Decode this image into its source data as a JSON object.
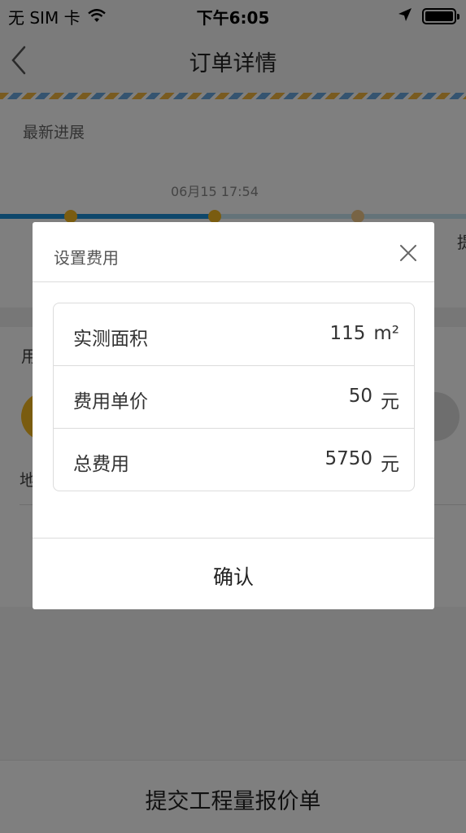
{
  "status_bar": {
    "carrier": "无 SIM 卡",
    "time": "下午6:05"
  },
  "nav": {
    "title": "订单详情"
  },
  "background": {
    "latest_progress_label": "最新进展",
    "progress_time": "06月15 17:54",
    "partial_labels": {
      "yong": "用",
      "di": "地",
      "ti": "提"
    },
    "submit_button_label": "提交工程量报价单"
  },
  "modal": {
    "title": "设置费用",
    "rows": [
      {
        "label": "实测面积",
        "value": "115",
        "unit": "m²"
      },
      {
        "label": "费用单价",
        "value": "50",
        "unit": "元"
      },
      {
        "label": "总费用",
        "value": "5750",
        "unit": "元"
      }
    ],
    "confirm_label": "确认"
  },
  "colors": {
    "accent_blue": "#1d8fd6",
    "accent_yellow": "#f5b821",
    "mask": "rgba(0,0,0,0.5)"
  },
  "icons": [
    "wifi-icon",
    "location-arrow-icon",
    "battery-icon",
    "back-chevron-icon",
    "close-icon"
  ]
}
